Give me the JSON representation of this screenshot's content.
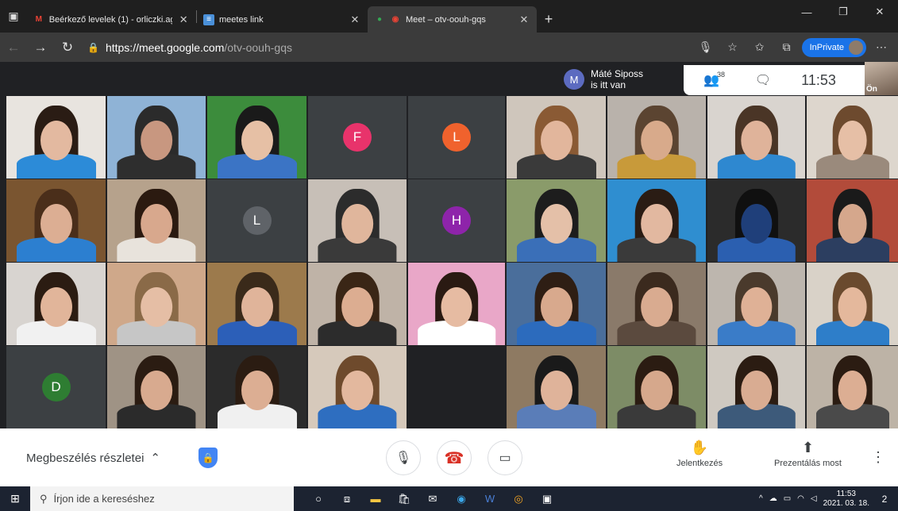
{
  "browser": {
    "tabs": [
      {
        "title": "Beérkező levelek (1) - orliczki.ag",
        "icon": "gmail-icon"
      },
      {
        "title": "meetes link",
        "icon": "doc-icon"
      },
      {
        "title": "Meet – otv-oouh-gqs",
        "icon": "meet-icon",
        "active": true
      }
    ],
    "url_host": "https://meet.google.com",
    "url_path": "/otv-oouh-gqs",
    "inprivate_label": "InPrivate"
  },
  "meet": {
    "toast": {
      "avatar_letter": "M",
      "line1": "Máté Siposs",
      "line2": "is itt van"
    },
    "participants_count": "38",
    "clock": "11:53",
    "self_label": "Ön",
    "tiles": [
      {
        "row": 0,
        "col": 0,
        "type": "video",
        "bg": "#e8e4df",
        "hair": "#2a1c14",
        "skin": "#e3b9a0",
        "shirt": "#2c8bd8"
      },
      {
        "row": 0,
        "col": 1,
        "type": "video",
        "bg": "#8fb3d6",
        "hair": "#2b2b2b",
        "skin": "#c89780",
        "shirt": "#2e2e2e"
      },
      {
        "row": 0,
        "col": 2,
        "type": "video",
        "bg": "#3c8c3c",
        "hair": "#1a1a1a",
        "skin": "#e6c0a5",
        "shirt": "#3b74c5"
      },
      {
        "row": 0,
        "col": 3,
        "type": "initial",
        "letter": "F",
        "color": "#e8336b"
      },
      {
        "row": 0,
        "col": 4,
        "type": "initial",
        "letter": "L",
        "color": "#f0622d"
      },
      {
        "row": 0,
        "col": 5,
        "type": "video",
        "bg": "#cfc6bc",
        "hair": "#8a5a34",
        "skin": "#e2b69c",
        "shirt": "#3a3a3a"
      },
      {
        "row": 0,
        "col": 6,
        "type": "video",
        "bg": "#b9b2ab",
        "hair": "#5b4431",
        "skin": "#d8aa8b",
        "shirt": "#c89a3a"
      },
      {
        "row": 0,
        "col": 7,
        "type": "video",
        "bg": "#d9d4cf",
        "hair": "#4a3526",
        "skin": "#dfb39a",
        "shirt": "#2e88d0"
      },
      {
        "row": 0,
        "col": 8,
        "type": "video",
        "bg": "#ddd6cd",
        "hair": "#6d4a2e",
        "skin": "#e6bfa6",
        "shirt": "#9a8a7c"
      },
      {
        "row": 1,
        "col": 0,
        "type": "video",
        "bg": "#7a5530",
        "hair": "#4a2e1a",
        "skin": "#dcae93",
        "shirt": "#2c7fd0"
      },
      {
        "row": 1,
        "col": 1,
        "type": "video",
        "bg": "#b6a28c",
        "hair": "#2b1a10",
        "skin": "#d8a88d",
        "shirt": "#e8e3dc"
      },
      {
        "row": 1,
        "col": 2,
        "type": "initial",
        "letter": "L",
        "color": "#5f6368"
      },
      {
        "row": 1,
        "col": 3,
        "type": "video",
        "bg": "#c7bfb7",
        "hair": "#2c2c2c",
        "skin": "#e0b69c",
        "shirt": "#3a3a3a"
      },
      {
        "row": 1,
        "col": 4,
        "type": "initial",
        "letter": "H",
        "color": "#8e24aa"
      },
      {
        "row": 1,
        "col": 5,
        "type": "video",
        "bg": "#8a9b6a",
        "hair": "#1d1d1d",
        "skin": "#e4c0a8",
        "shirt": "#3a6fb8"
      },
      {
        "row": 1,
        "col": 6,
        "type": "video",
        "bg": "#2f8ed0",
        "hair": "#2a1c14",
        "skin": "#e2b8a0",
        "shirt": "#3a3a3a"
      },
      {
        "row": 1,
        "col": 7,
        "type": "video",
        "bg": "#2b2b2b",
        "hair": "#101010",
        "skin": "#1f3f7a",
        "shirt": "#2b5fb0"
      },
      {
        "row": 1,
        "col": 8,
        "type": "video",
        "bg": "#b24b3a",
        "hair": "#1a1a1a",
        "skin": "#d5a78c",
        "shirt": "#2c3e60"
      },
      {
        "row": 2,
        "col": 0,
        "type": "video",
        "bg": "#d8d4d0",
        "hair": "#2b1c12",
        "skin": "#e1b59a",
        "shirt": "#f1f1f1"
      },
      {
        "row": 2,
        "col": 1,
        "type": "video",
        "bg": "#cfa88a",
        "hair": "#8a6a48",
        "skin": "#e5bea5",
        "shirt": "#c6c6c6"
      },
      {
        "row": 2,
        "col": 2,
        "type": "video",
        "bg": "#9c7a4c",
        "hair": "#3a2a1a",
        "skin": "#e0b49a",
        "shirt": "#2c5fb8"
      },
      {
        "row": 2,
        "col": 3,
        "type": "video",
        "bg": "#bfb3a7",
        "hair": "#3a2616",
        "skin": "#dcad91",
        "shirt": "#2c2c2c"
      },
      {
        "row": 2,
        "col": 4,
        "type": "video",
        "bg": "#e9a7c8",
        "hair": "#2a1a12",
        "skin": "#e6bba2",
        "shirt": "#ffffff"
      },
      {
        "row": 2,
        "col": 5,
        "type": "video",
        "bg": "#4a6e9b",
        "hair": "#2e1e14",
        "skin": "#d8a98d",
        "shirt": "#2c6bbd"
      },
      {
        "row": 2,
        "col": 6,
        "type": "video",
        "bg": "#8a7a6a",
        "hair": "#3b2a1e",
        "skin": "#d9ab90",
        "shirt": "#5b4a3e"
      },
      {
        "row": 2,
        "col": 7,
        "type": "video",
        "bg": "#bdb6ae",
        "hair": "#4a3a2c",
        "skin": "#dfb196",
        "shirt": "#3a7cc8"
      },
      {
        "row": 2,
        "col": 8,
        "type": "video",
        "bg": "#d9d2c8",
        "hair": "#6a4a2e",
        "skin": "#e4b89c",
        "shirt": "#2e7ec9"
      },
      {
        "row": 3,
        "col": 0,
        "type": "initial",
        "letter": "D",
        "color": "#2e7d32"
      },
      {
        "row": 3,
        "col": 1,
        "type": "video",
        "bg": "#9f9385",
        "hair": "#2b1c12",
        "skin": "#d8aa8f",
        "shirt": "#2b2b2b"
      },
      {
        "row": 3,
        "col": 2,
        "type": "video",
        "bg": "#2b2b2b",
        "hair": "#2b1c12",
        "skin": "#dcae93",
        "shirt": "#f0f0f0"
      },
      {
        "row": 3,
        "col": 3,
        "type": "video",
        "bg": "#d6c9bb",
        "hair": "#6e4a2c",
        "skin": "#e3b89e",
        "shirt": "#2e6ec0"
      },
      {
        "row": 3,
        "col": 4,
        "type": "empty"
      },
      {
        "row": 3,
        "col": 5,
        "type": "video",
        "bg": "#8e7a62",
        "hair": "#1a1a1a",
        "skin": "#dfb39a",
        "shirt": "#5a7db8"
      },
      {
        "row": 3,
        "col": 6,
        "type": "video",
        "bg": "#7d8c66",
        "hair": "#2b1c12",
        "skin": "#d6a88c",
        "shirt": "#3a3a3a"
      },
      {
        "row": 3,
        "col": 7,
        "type": "video",
        "bg": "#cfc9c1",
        "hair": "#2b1c12",
        "skin": "#d9ac92",
        "shirt": "#3d5a7a"
      },
      {
        "row": 3,
        "col": 8,
        "type": "video",
        "bg": "#bdb3a6",
        "hair": "#2b1c12",
        "skin": "#dcae93",
        "shirt": "#4a4a4a"
      }
    ]
  },
  "bottom": {
    "details_label": "Megbeszélés részletei",
    "raise_hand_label": "Jelentkezés",
    "present_label": "Prezentálás most"
  },
  "taskbar": {
    "search_placeholder": "Írjon ide a kereséshez",
    "time": "11:53",
    "date": "2021. 03. 18.",
    "notif_count": "2"
  }
}
